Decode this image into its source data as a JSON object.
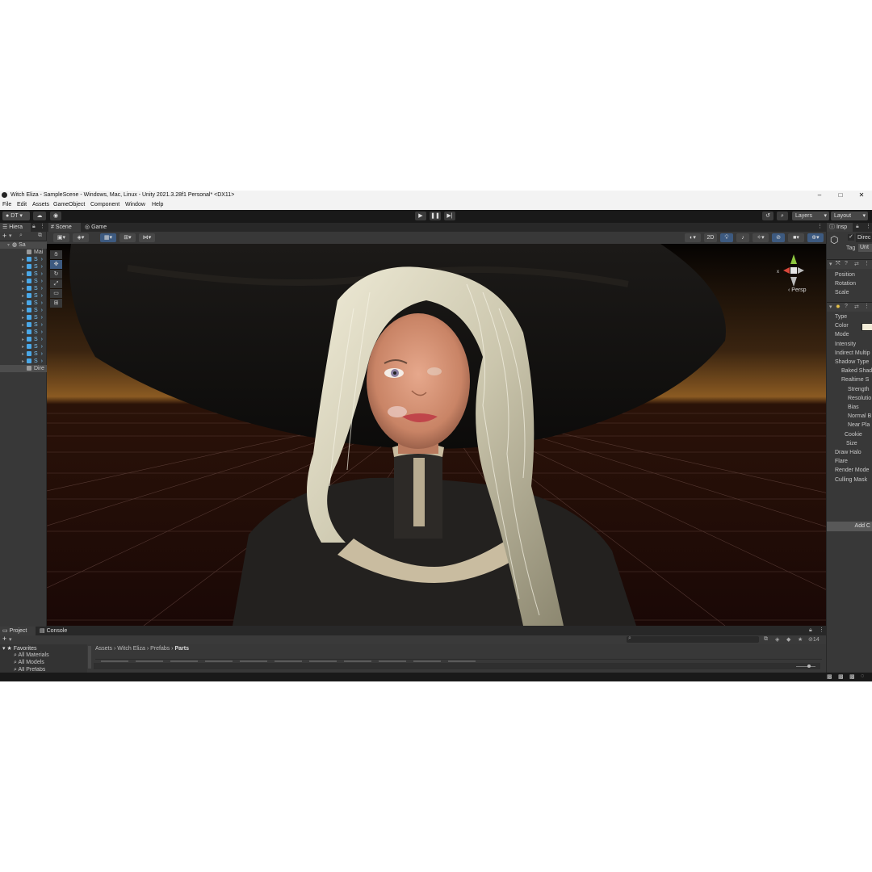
{
  "window": {
    "title": "Witch Eliza - SampleScene - Windows, Mac, Linux - Unity 2021.3.28f1 Personal* <DX11>",
    "minimize": "–",
    "maximize": "□",
    "close": "✕"
  },
  "menu": [
    "File",
    "Edit",
    "Assets",
    "GameObject",
    "Component",
    "Window",
    "Help"
  ],
  "toolbar": {
    "account": "DT",
    "layers": "Layers",
    "layout": "Layout",
    "play_icon": "play-icon",
    "pause_icon": "pause-icon",
    "step_icon": "step-icon"
  },
  "hierarchy": {
    "tab": "Hiera",
    "add": "+",
    "scene": "Sa",
    "items": [
      "Mai",
      "S",
      "S",
      "S",
      "S",
      "S",
      "S",
      "S",
      "S",
      "S",
      "S",
      "S",
      "S",
      "S",
      "S",
      "S"
    ],
    "last": "Dire"
  },
  "scene": {
    "tab_scene": "Scene",
    "tab_game": "Game",
    "mode_2d": "2D",
    "persp": "Persp"
  },
  "inspector": {
    "tab": "Insp",
    "object_name": "Direc",
    "tag_label": "Tag",
    "tag_value": "Unt",
    "transform_rows": [
      "Position",
      "Rotation",
      "Scale"
    ],
    "light_rows": [
      "Type",
      "Color",
      "Mode",
      "Intensity",
      "Indirect Multip",
      "Shadow Type",
      "Baked Shad",
      "Realtime S",
      "Strength",
      "Resolutio",
      "Bias",
      "Normal B",
      "Near Pla",
      "Cookie",
      "Size",
      "Draw Halo",
      "Flare",
      "Render Mode",
      "Culling Mask"
    ],
    "add_component": "Add C",
    "color_value": "#f2ecd8"
  },
  "project": {
    "tab_project": "Project",
    "tab_console": "Console",
    "add": "+",
    "favorites": "Favorites",
    "fav_items": [
      "All Materials",
      "All Models",
      "All Prefabs"
    ],
    "breadcrumb": [
      "Assets",
      "Witch Eliza",
      "Prefabs",
      "Parts"
    ],
    "count": "14"
  }
}
